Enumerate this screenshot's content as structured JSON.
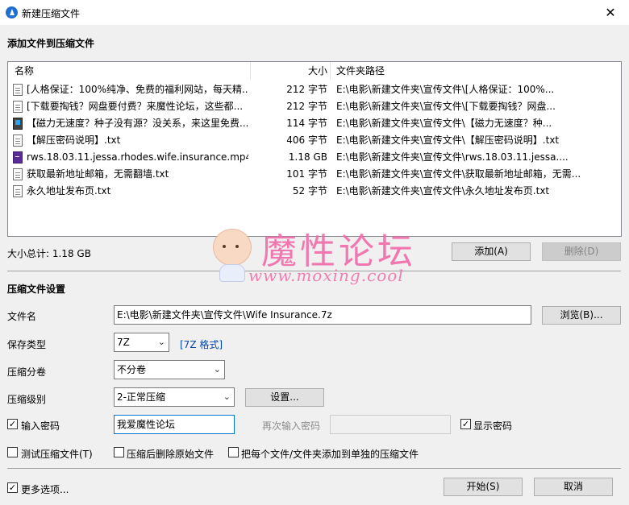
{
  "window": {
    "title": "新建压缩文件",
    "close_glyph": "✕"
  },
  "add_section": {
    "title": "添加文件到压缩文件"
  },
  "columns": {
    "name": "名称",
    "size": "大小",
    "path": "文件夹路径"
  },
  "files": [
    {
      "icon": "text-file-icon",
      "name": "[人格保证：100%纯净、免费的福利网站，每天精...",
      "size": "212 字节",
      "path": "E:\\电影\\新建文件夹\\宣传文件\\[人格保证：100%..."
    },
    {
      "icon": "text-file-icon",
      "name": "[下载要掏钱？网盘要付费？来魔性论坛，这些都...",
      "size": "212 字节",
      "path": "E:\\电影\\新建文件夹\\宣传文件\\[下载要掏钱？网盘..."
    },
    {
      "icon": "url-file-icon",
      "name": "【磁力无速度？种子没有源？没关系，来这里免费...",
      "size": "114 字节",
      "path": "E:\\电影\\新建文件夹\\宣传文件\\【磁力无速度？种..."
    },
    {
      "icon": "text-file-icon",
      "name": "【解压密码说明】.txt",
      "size": "406 字节",
      "path": "E:\\电影\\新建文件夹\\宣传文件\\【解压密码说明】.txt"
    },
    {
      "icon": "video-file-icon",
      "name": "rws.18.03.11.jessa.rhodes.wife.insurance.mp4",
      "size": "1.18 GB",
      "path": "E:\\电影\\新建文件夹\\宣传文件\\rws.18.03.11.jessa...."
    },
    {
      "icon": "text-file-icon",
      "name": "获取最新地址邮箱，无需翻墙.txt",
      "size": "101 字节",
      "path": "E:\\电影\\新建文件夹\\宣传文件\\获取最新地址邮箱，无需..."
    },
    {
      "icon": "text-file-icon",
      "name": "永久地址发布页.txt",
      "size": "52 字节",
      "path": "E:\\电影\\新建文件夹\\宣传文件\\永久地址发布页.txt"
    }
  ],
  "total": {
    "label": "大小总计: 1.18 GB"
  },
  "buttons": {
    "add": "添加(A)",
    "delete": "删除(D)",
    "browse": "浏览(B)...",
    "settings": "设置...",
    "start": "开始(S)",
    "cancel": "取消"
  },
  "settings": {
    "title": "压缩文件设置",
    "filename_label": "文件名",
    "filename_value": "E:\\电影\\新建文件夹\\宣传文件\\Wife Insurance.7z",
    "type_label": "保存类型",
    "type_value": "7Z",
    "type_link": "[7Z 格式]",
    "split_label": "压缩分卷",
    "split_value": "不分卷",
    "level_label": "压缩级别",
    "level_value": "2-正常压缩",
    "password_label": "输入密码",
    "password_value": "我爱魔性论坛",
    "password_checked": true,
    "reenter_label": "再次输入密码",
    "reenter_value": "",
    "show_password_label": "显示密码",
    "show_password_checked": true
  },
  "options": {
    "test": "测试压缩文件(T)",
    "delete_source": "压缩后删除原始文件",
    "separate": "把每个文件/文件夹添加到单独的压缩文件",
    "more": "更多选项...",
    "more_checked": true
  },
  "watermark": {
    "text": "魔性论坛",
    "url": "www.moxing.cool",
    "color": "#f06aa8"
  }
}
